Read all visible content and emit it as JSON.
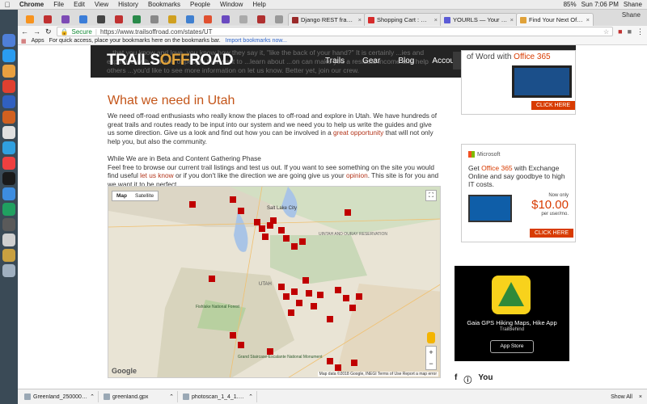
{
  "menubar": {
    "app": "Chrome",
    "items": [
      "File",
      "Edit",
      "View",
      "History",
      "Bookmarks",
      "People",
      "Window",
      "Help"
    ],
    "battery": "85%",
    "clock": "Sun 7:06 PM",
    "user": "Shane"
  },
  "tabs": [
    {
      "title": "Django REST framework",
      "active": false,
      "color": "#9a2a2a"
    },
    {
      "title": "Shopping Cart : Mpix",
      "active": false,
      "color": "#d62b2b"
    },
    {
      "title": "YOURLS — Your Own U",
      "active": false,
      "color": "#5b5bd6"
    },
    {
      "title": "Find Your Next Offroad",
      "active": true,
      "color": "#e0a23a"
    }
  ],
  "profile_name": "Shane",
  "omnibox": {
    "secure_label": "Secure",
    "url": "https://www.trailsoffroad.com/states/UT"
  },
  "bookmarks": {
    "apps": "Apps",
    "text": "For quick access, place your bookmarks here on the bookmarks bar.",
    "link": "Import bookmarks now..."
  },
  "site": {
    "logo_trails": "TRAILS",
    "logo_off": "OFF",
    "logo_road": "ROAD",
    "nav": [
      "Trails",
      "Gear",
      "Blog",
      "Account"
    ],
    "header_bg_text": "...that you know and love, you know how they say it, \"like the back of your hand?\" It is certainly ...ies and expertise with a crowd of people that want to ...learn about ...on can make you a residual income and help others ...you'd like to see more information on let us know. Better yet, join our crew."
  },
  "main": {
    "title": "What we need in Utah",
    "p1_a": "We need off-road enthusiasts who really know the places to off-road and explore in Utah.  We have hundreds of great trails and routes ready to be input into our system and we need you to help us write the guides and give us some direction.  Give us a look and find out how you can be involved in a ",
    "p1_link": "great opportunity",
    "p1_b": " that will not only help you, but also the community.",
    "p2_heading": "While We are in Beta and Content Gathering Phase",
    "p2_a": "Feel free to browse our current trail listings and test us out.  If you want to see something on the site you would find useful ",
    "p2_link1": "let us know",
    "p2_b": " or if you don't like the direction we are going give us your ",
    "p2_link2": "opinion",
    "p2_c": ".  This site is for you and we want it to be perfect."
  },
  "map": {
    "toggle_map": "Map",
    "toggle_satellite": "Satellite",
    "labels": {
      "salt_lake": "Salt Lake City",
      "reservation": "UINTAH AND OURAY RESERVATION",
      "national_forest": "Fishlake National Forest",
      "grand_staircase": "Grand Staircase-Escalante National Monument",
      "utah": "UTAH"
    },
    "google": "Google",
    "footer": "Map data ©2018 Google, INEGI   Terms of Use   Report a map error",
    "zoom_in": "+",
    "zoom_out": "−"
  },
  "ads": {
    "ad1_text": "of Word with",
    "ad1_brand": "Office 365",
    "click_here": "CLICK HERE",
    "ad2_ms": "Microsoft",
    "ad2_head_a": "Get ",
    "ad2_head_brand": "Office 365",
    "ad2_head_b": " with Exchange Online and say goodbye to high IT costs.",
    "ad2_only": "Now only",
    "ad2_price": "$10.00",
    "ad2_per": "per user/mo.",
    "ad3_title": "Gaia GPS Hiking Maps, Hike App",
    "ad3_sub": "TrailBehind",
    "ad3_store": "App Store"
  },
  "social": [
    "f",
    "ⓘ",
    "You"
  ],
  "downloads": [
    "Greenland_2500000.json",
    "greenland.gpx",
    "photoscan_1_4_1.dmg"
  ],
  "show_all": "Show All"
}
